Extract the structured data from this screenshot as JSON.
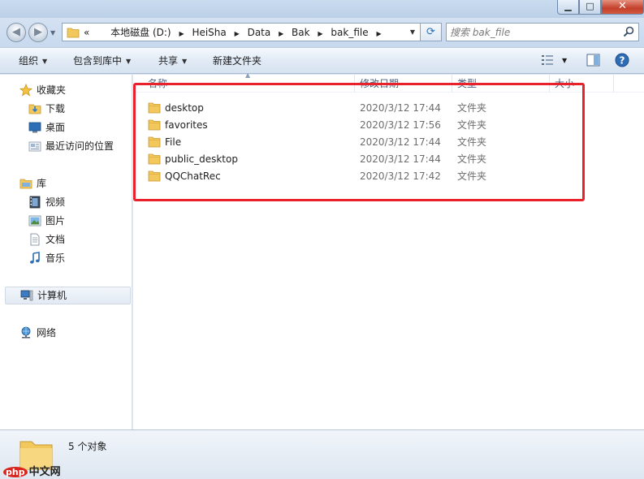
{
  "window": {
    "controls": {
      "minimize": "▁",
      "maximize": "□",
      "close": "✕"
    }
  },
  "nav": {
    "back_glyph": "◀",
    "forward_glyph": "▶",
    "dropdown_glyph": "▼",
    "address": {
      "overflow": "«",
      "crumbs": [
        "本地磁盘 (D:)",
        "HeiSha",
        "Data",
        "Bak",
        "bak_file"
      ],
      "separator": "▶"
    },
    "refresh_glyph": "⟳",
    "search": {
      "placeholder": "搜索 bak_file",
      "icon": "search-icon"
    }
  },
  "toolbar": {
    "organize": "组织",
    "include_in_library": "包含到库中",
    "share": "共享",
    "new_folder": "新建文件夹",
    "dropdown_glyph": "▼"
  },
  "sidebar": {
    "favorites": {
      "header": "收藏夹",
      "items": [
        "下载",
        "桌面",
        "最近访问的位置"
      ]
    },
    "libraries": {
      "header": "库",
      "items": [
        "视频",
        "图片",
        "文档",
        "音乐"
      ]
    },
    "computer": "计算机",
    "network": "网络"
  },
  "columns": {
    "name": "名称",
    "date_modified": "修改日期",
    "type": "类型",
    "size": "大小",
    "sort_glyph": "▲"
  },
  "files": [
    {
      "name": "desktop",
      "date": "2020/3/12 17:44",
      "type": "文件夹"
    },
    {
      "name": "favorites",
      "date": "2020/3/12 17:56",
      "type": "文件夹"
    },
    {
      "name": "File",
      "date": "2020/3/12 17:44",
      "type": "文件夹"
    },
    {
      "name": "public_desktop",
      "date": "2020/3/12 17:44",
      "type": "文件夹"
    },
    {
      "name": "QQChatRec",
      "date": "2020/3/12 17:42",
      "type": "文件夹"
    }
  ],
  "status": {
    "count": "5 个对象"
  },
  "watermark": {
    "badge": "php",
    "text": "中文网"
  },
  "colors": {
    "highlight": "#e8212a",
    "folder": "#f2c75c"
  }
}
